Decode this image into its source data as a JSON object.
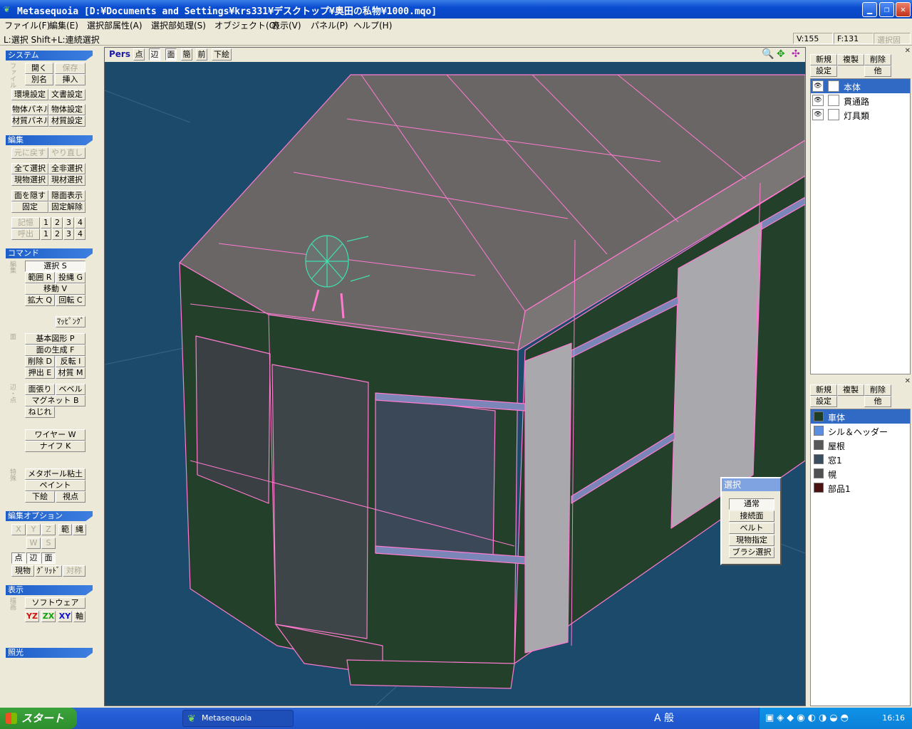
{
  "window": {
    "title": "Metasequoia [D:¥Documents and Settings¥krs331¥デスクトップ¥奥田の私物¥1000.mqo]",
    "icon": "sequoia-leaf-icon"
  },
  "menu": [
    "ファイル(F)",
    "編集(E)",
    "選択部属性(A)",
    "選択部処理(S)",
    "オブジェクト(O)",
    "表示(V)",
    "パネル(P)",
    "ヘルプ(H)"
  ],
  "status": {
    "hint": "L:選択  Shift+L:連続選択",
    "vertices": "V:155",
    "faces": "F:131",
    "fix_label": "選択固定"
  },
  "left": {
    "system": {
      "title": "システム",
      "side_label": "ファイル",
      "open": "開く",
      "save": "保存",
      "save_as": "別名",
      "insert": "挿入",
      "env": "環境設定",
      "doc": "文書設定",
      "obj_panel": "物体パネル",
      "obj_set": "物体設定",
      "mat_panel": "材質パネル",
      "mat_set": "材質設定"
    },
    "edit": {
      "title": "編集",
      "undo": "元に戻す",
      "redo": "やり直し",
      "select_all": "全て選択",
      "deselect_all": "全非選択",
      "cur_obj_sel": "現物選択",
      "cur_mat_sel": "現材選択",
      "hide_face": "面を隠す",
      "show_hidden": "隠面表示",
      "fix": "固定",
      "unfix": "固定解除",
      "memo": "記憶",
      "recall": "呼出",
      "slots": [
        "1",
        "2",
        "3",
        "4"
      ]
    },
    "command": {
      "title": "コマンド",
      "side_edit": "編集",
      "select": "選択 S",
      "range": "範囲 R",
      "lasso": "投縄 G",
      "move": "移動 V",
      "scale": "拡大 Q",
      "rotate": "回転 C",
      "mapping": "ﾏｯﾋﾟﾝｸﾞ",
      "side_face": "面",
      "primitive": "基本図形 P",
      "face_gen": "面の生成 F",
      "delete": "削除 D",
      "flip": "反転 I",
      "extrude": "押出 E",
      "material": "材質 M",
      "side_vertex": "辺・点",
      "face_stretch": "面張り",
      "bevel": "ベベル",
      "magnet": "マグネット B",
      "twist": "ねじれ",
      "wire": "ワイヤー W",
      "knife": "ナイフ K",
      "side_special": "特殊",
      "metaball": "メタボール粘土",
      "paint": "ペイント",
      "sketch": "下絵",
      "viewpoint": "視点"
    },
    "options": {
      "title": "編集オプション",
      "x": "X",
      "y": "Y",
      "z": "Z",
      "range": "範",
      "lasso": "縄",
      "w": "W",
      "s": "S",
      "point": "点",
      "edge": "辺",
      "face": "面",
      "cur_obj": "現物",
      "grid": "ｸﾞﾘｯﾄﾞ",
      "symmetry": "対称"
    },
    "display": {
      "title": "表示",
      "side_label": "描画",
      "software": "ソフトウェア",
      "yz": "YZ",
      "zx": "ZX",
      "xy": "XY",
      "axis": "軸"
    },
    "light": {
      "title": "照光"
    }
  },
  "viewport": {
    "mode": "Pers",
    "point": "点",
    "edge": "辺",
    "face": "面",
    "simple": "簡",
    "front": "前",
    "sketch": "下絵",
    "zoom_icon": "magnifier-icon",
    "pan_icon": "move-arrows-icon",
    "rotate_icon": "rotate-arrows-icon"
  },
  "objects": {
    "new": "新規",
    "copy": "複製",
    "delete": "削除",
    "settings": "設定",
    "other": "他",
    "items": [
      "本体",
      "貫通路",
      "灯具類"
    ]
  },
  "materials": {
    "new": "新規",
    "copy": "複製",
    "delete": "削除",
    "settings": "設定",
    "other": "他",
    "items": [
      {
        "name": "車体",
        "color": "#1e3d26"
      },
      {
        "name": "シル＆ヘッダー",
        "color": "#5b8ee0"
      },
      {
        "name": "屋根",
        "color": "#585858"
      },
      {
        "name": "窓1",
        "color": "#3a4e60"
      },
      {
        "name": "幌",
        "color": "#505050"
      },
      {
        "name": "部品1",
        "color": "#4a1212"
      }
    ]
  },
  "select_popup": {
    "title": "選択",
    "options": [
      "通常",
      "接続面",
      "ベルト",
      "現物指定",
      "ブラシ選択"
    ]
  },
  "taskbar": {
    "start": "スタート",
    "app": "Metasequoia",
    "ime": "A 般",
    "clock": "16:16"
  },
  "colors": {
    "viewport_bg": "#1b4a6a",
    "wire": "#ff7ad0",
    "selected_wire": "#40e0b0",
    "title_blue": "#0a4cd0"
  }
}
